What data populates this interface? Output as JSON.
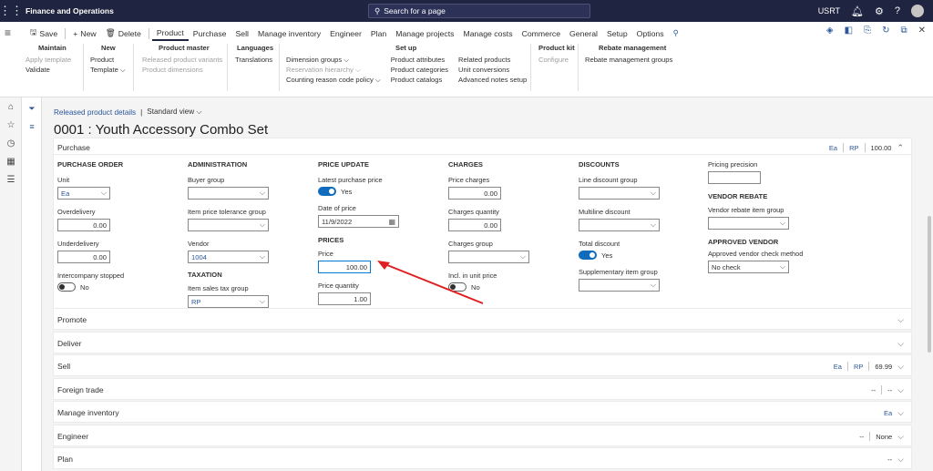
{
  "app": {
    "title": "Finance and Operations",
    "search_placeholder": "Search for a page",
    "company": "USRT"
  },
  "tabs": [
    {
      "label": "Save"
    },
    {
      "label": "New"
    },
    {
      "label": "Delete"
    },
    {
      "label": "Product"
    },
    {
      "label": "Purchase"
    },
    {
      "label": "Sell"
    },
    {
      "label": "Manage inventory"
    },
    {
      "label": "Engineer"
    },
    {
      "label": "Plan"
    },
    {
      "label": "Manage projects"
    },
    {
      "label": "Manage costs"
    },
    {
      "label": "Commerce"
    },
    {
      "label": "General"
    },
    {
      "label": "Setup"
    },
    {
      "label": "Options"
    }
  ],
  "groups": {
    "maintain": {
      "title": "Maintain",
      "items": [
        "Apply template",
        "Validate"
      ]
    },
    "new": {
      "title": "New",
      "items": [
        "Product",
        "Template"
      ]
    },
    "product_master": {
      "title": "Product master",
      "items": [
        "Released product variants",
        "Product dimensions"
      ]
    },
    "languages": {
      "title": "Languages",
      "items": [
        "Translations"
      ]
    },
    "setup": {
      "title": "Set up",
      "col1": [
        "Dimension groups",
        "Reservation hierarchy",
        "Counting reason code policy"
      ],
      "col2": [
        "Product attributes",
        "Product categories",
        "Product catalogs"
      ],
      "col3": [
        "Related products",
        "Unit conversions",
        "Advanced notes setup"
      ]
    },
    "product_kit": {
      "title": "Product kit",
      "items": [
        "Configure"
      ]
    },
    "rebate": {
      "title": "Rebate management",
      "items": [
        "Rebate management groups"
      ]
    }
  },
  "breadcrumb": {
    "link": "Released product details",
    "separator": "|",
    "view": "Standard view"
  },
  "page_title": "0001 : Youth Accessory Combo Set",
  "purchase": {
    "title": "Purchase",
    "summary": {
      "unit": "Ea",
      "group": "RP",
      "price": "100.00"
    },
    "purchase_order": {
      "heading": "PURCHASE ORDER",
      "unit_label": "Unit",
      "unit": "Ea",
      "overdelivery_label": "Overdelivery",
      "overdelivery": "0.00",
      "underdelivery_label": "Underdelivery",
      "underdelivery": "0.00",
      "intercompany_label": "Intercompany stopped",
      "intercompany": "No"
    },
    "administration": {
      "heading": "ADMINISTRATION",
      "buyer_group_label": "Buyer group",
      "buyer_group": "",
      "tolerance_label": "Item price tolerance group",
      "tolerance": "",
      "vendor_label": "Vendor",
      "vendor": "1004"
    },
    "taxation": {
      "heading": "TAXATION",
      "tax_group_label": "Item sales tax group",
      "tax_group": "RP"
    },
    "price_update": {
      "heading": "PRICE UPDATE",
      "latest_label": "Latest purchase price",
      "latest": "Yes",
      "date_label": "Date of price",
      "date": "11/9/2022"
    },
    "prices": {
      "heading": "PRICES",
      "price_label": "Price",
      "price": "100.00",
      "qty_label": "Price quantity",
      "qty": "1.00"
    },
    "charges": {
      "heading": "CHARGES",
      "charges_label": "Price charges",
      "charges": "0.00",
      "cqty_label": "Charges quantity",
      "cqty": "0.00",
      "cgroup_label": "Charges group",
      "cgroup": "",
      "incl_label": "Incl. in unit price",
      "incl": "No"
    },
    "discounts": {
      "heading": "DISCOUNTS",
      "line_label": "Line discount group",
      "line": "",
      "multi_label": "Multiline discount",
      "multi": "",
      "total_label": "Total discount",
      "total": "Yes",
      "supp_label": "Supplementary item group",
      "supp": ""
    },
    "precision": {
      "label": "Pricing precision",
      "value": ""
    },
    "vendor_rebate": {
      "heading": "VENDOR REBATE",
      "label": "Vendor rebate item group",
      "value": ""
    },
    "approved_vendor": {
      "heading": "APPROVED VENDOR",
      "label": "Approved vendor check method",
      "value": "No check"
    }
  },
  "sections": [
    {
      "title": "Promote",
      "summary": []
    },
    {
      "title": "Deliver",
      "summary": []
    },
    {
      "title": "Sell",
      "summary": [
        "Ea",
        "RP",
        "69.99"
      ]
    },
    {
      "title": "Foreign trade",
      "summary": [
        "--",
        "--"
      ]
    },
    {
      "title": "Manage inventory",
      "summary": [
        "Ea"
      ]
    },
    {
      "title": "Engineer",
      "summary": [
        "--",
        "None"
      ]
    },
    {
      "title": "Plan",
      "summary": [
        "--"
      ]
    }
  ],
  "colors": {
    "nav_bar": "#1f2440",
    "accent": "#0f6cbd",
    "link": "#2b579a",
    "annotation_arrow": "#e02020"
  }
}
